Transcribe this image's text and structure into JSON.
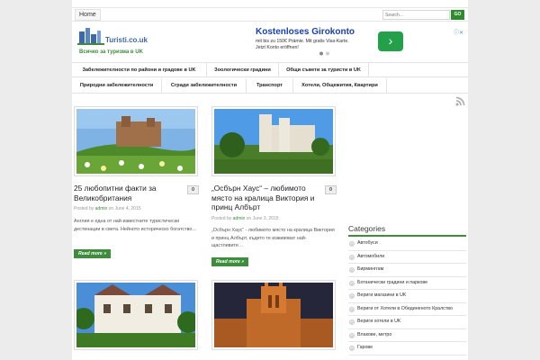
{
  "topbar": {
    "home": "Home",
    "search_placeholder": "Search...",
    "go": "GO"
  },
  "logo": {
    "name": "Turisti.co.uk",
    "tagline": "Всичко за туризма в UK"
  },
  "ad": {
    "title": "Kostenloses Girokonto",
    "text": "mit bis zu 150€ Prämie. Mit gratis Visa-Karte. Jetzt Konto eröffnen!",
    "arrow": "›",
    "info": "ⓘ✕",
    "accent": "#24a04a"
  },
  "nav": {
    "row1": [
      "Забележителности по райони и градове в UK",
      "Зоологически градини",
      "Общи съвети за туристи в UK"
    ],
    "row2": [
      "Природни забележителности",
      "Сгради забележителности",
      "Транспорт",
      "Хотели, Общежития, Квартири"
    ]
  },
  "posts": [
    {
      "title": "25 любопитни факти за Великобритания",
      "comments": "0",
      "meta_prefix": "Posted by",
      "author": "admin",
      "meta_date": "on June 4, 2015",
      "excerpt": "Англия е една от най-известните туристически дестинации в света. Нейното историческо богатство…",
      "read_more": "Read more »"
    },
    {
      "title": "„Осбърн Хаус“ – любимото място на кралица Виктория и принц Албърт",
      "comments": "0",
      "meta_prefix": "Posted by",
      "author": "admin",
      "meta_date": "on June 3, 2015",
      "excerpt": "„Осбърн Хаус“ - любимото място на кралица Виктория и принц Албърт, където те изживяват най-щастливите…",
      "read_more": "Read more »"
    }
  ],
  "sidebar": {
    "categories_title": "Categories",
    "categories": [
      "Автобуси",
      "Автомобили",
      "Бирминггам",
      "Ботанически градини и паркове",
      "Вериги магазини в UK",
      "Вериги от Хотели в Обединеното Кралство",
      "Вериги хотели в UK",
      "Влакове, метро",
      "Гарове"
    ]
  },
  "colors": {
    "green": "#3d8d3d",
    "link_blue": "#1a3faf"
  }
}
